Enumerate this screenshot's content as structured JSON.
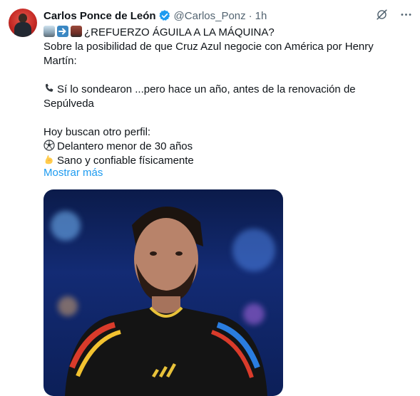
{
  "tweet": {
    "author_name": "Carlos Ponce de León",
    "handle": "@Carlos_Ponz",
    "separator": "·",
    "time": "1h",
    "lines": [
      "¿REFUERZO ÁGUILA A LA MÁQUINA?",
      "Sobre la posibilidad de que Cruz Azul negocie con América por Henry",
      "Martín:",
      "",
      "Sí lo sondearon ...pero hace un año, antes de la renovación de",
      "Sepúlveda",
      "",
      "Hoy buscan otro perfil:",
      "Delantero menor de 30 años",
      "Sano y confiable físicamente"
    ],
    "show_more": "Mostrar más"
  },
  "icons": {
    "verified": "verified-badge-icon",
    "grok": "grok-icon",
    "more": "more-options-icon",
    "line1_emojis": [
      "eagle-icon",
      "right-arrow-icon",
      "train-icon"
    ],
    "phone": "telephone-icon",
    "soccer": "soccer-ball-icon",
    "muscle": "flexed-biceps-icon"
  },
  "colors": {
    "text": "#0f1419",
    "secondary": "#536471",
    "link": "#1d9bf0",
    "verified": "#1d9bf0"
  }
}
